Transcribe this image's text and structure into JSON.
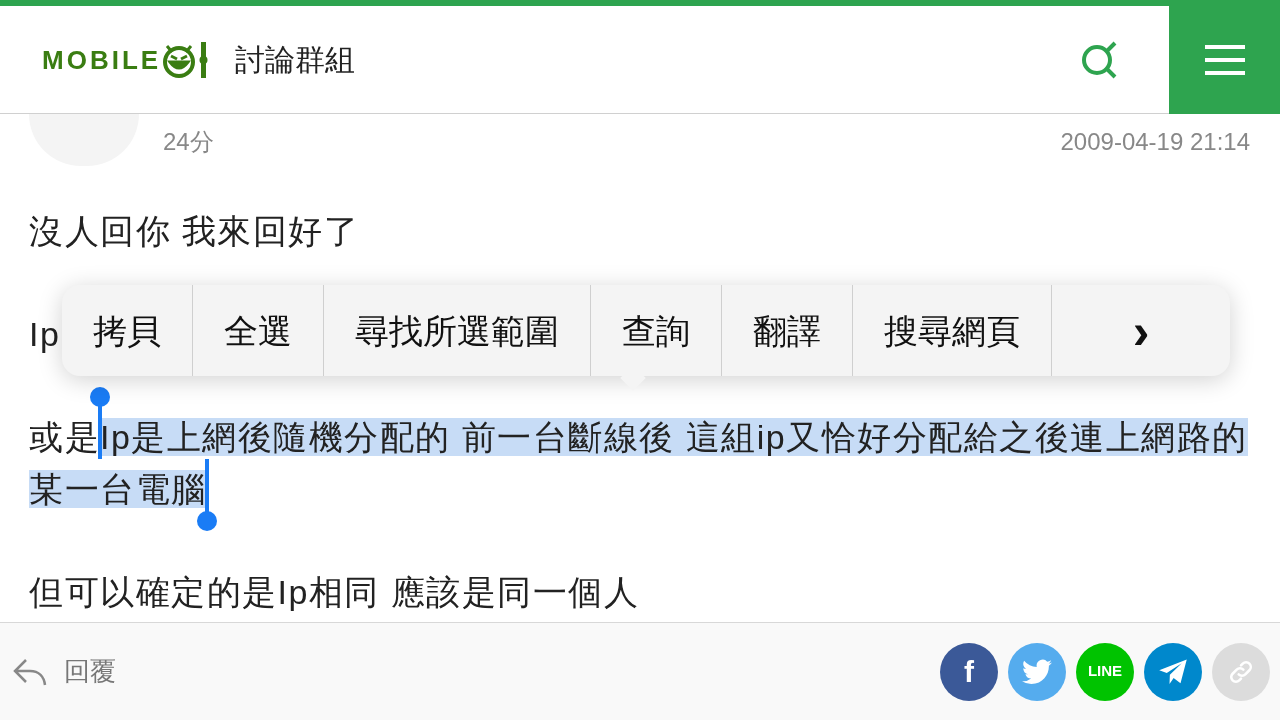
{
  "header": {
    "logo": "MOBILE",
    "title": "討論群組"
  },
  "post": {
    "score": "24分",
    "date": "2009-04-19 21:14",
    "paragraphs": [
      {
        "kind": "plain",
        "text": "沒人回你 我來回好了"
      },
      {
        "kind": "plain",
        "text": "Ip"
      },
      {
        "kind": "selection",
        "before": "或是",
        "selected_text": "Ip是上網後隨機分配的 前一台斷線後 這組ip又恰好分配給之後連上網路的某一台電腦"
      },
      {
        "kind": "plain",
        "text": "但可以確定的是Ip相同 應該是同一個人"
      }
    ]
  },
  "context_menu": {
    "items": [
      "拷貝",
      "全選",
      "尋找所選範圍",
      "查詢",
      "翻譯",
      "搜尋網頁"
    ],
    "more": "›"
  },
  "footer": {
    "reply": "回覆",
    "share": [
      {
        "kind": "facebook",
        "color": "#3b5998",
        "label": "f"
      },
      {
        "kind": "twitter",
        "color": "#55acee"
      },
      {
        "kind": "line",
        "color": "#00c300",
        "label": "LINE"
      },
      {
        "kind": "telegram",
        "color": "#0088cc"
      },
      {
        "kind": "link",
        "color": "#dcdcdc"
      }
    ]
  }
}
